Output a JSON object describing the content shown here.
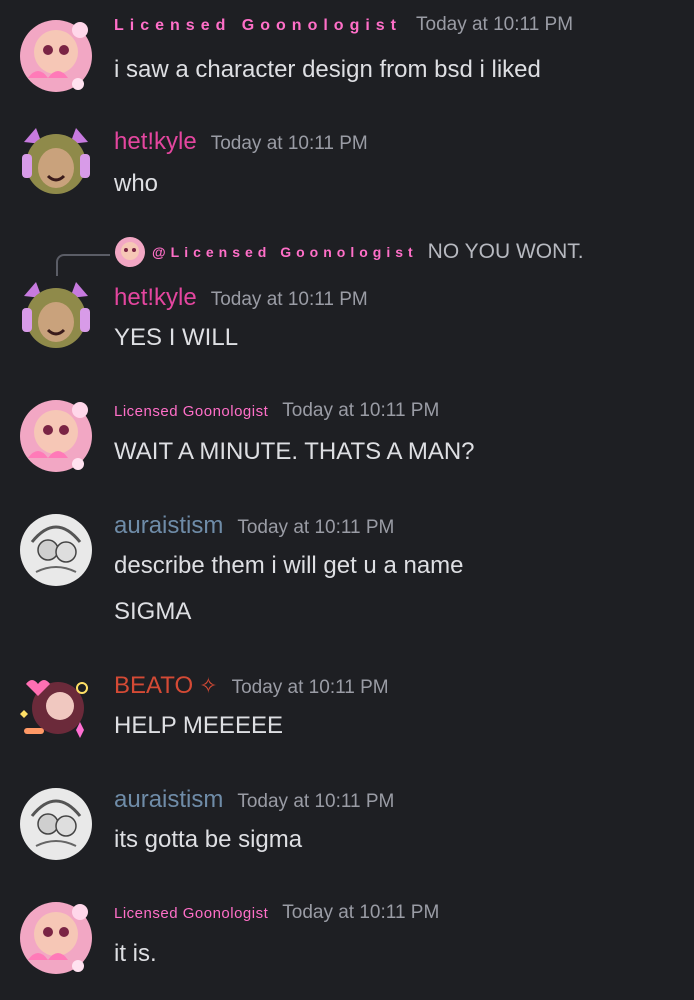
{
  "messages": [
    {
      "author": "Licensed Goonologist",
      "timestamp": "Today at 10:11 PM",
      "text": "i saw a character design from bsd i liked"
    },
    {
      "author": "het!kyle",
      "timestamp": "Today at 10:11 PM",
      "text": "who"
    },
    {
      "reply": {
        "mention": "@Licensed Goonologist",
        "text": "NO YOU WONT."
      },
      "author": "het!kyle",
      "timestamp": "Today at 10:11 PM",
      "text": "YES I WILL"
    },
    {
      "author": "Licensed Goonologist",
      "timestamp": "Today at 10:11 PM",
      "text": "WAIT A MINUTE. THATS A MAN?"
    },
    {
      "author": "auraistism",
      "timestamp": "Today at 10:11 PM",
      "text": "describe them i will get u a name",
      "text2": "SIGMA"
    },
    {
      "author": "BEATO",
      "badge": "✧",
      "timestamp": "Today at 10:11 PM",
      "text": "HELP MEEEEE"
    },
    {
      "author": "auraistism",
      "timestamp": "Today at 10:11 PM",
      "text": "its gotta be sigma"
    },
    {
      "author": "Licensed Goonologist",
      "timestamp": "Today at 10:11 PM",
      "text": "it is."
    }
  ],
  "colors": {
    "background": "#1e1f23",
    "goonologist": "#ff6fc8",
    "kyle": "#e4469f",
    "auraistism": "#6f8ca8",
    "beato": "#d44a35",
    "timestamp": "#9a9ca5"
  },
  "icons": [
    "avatar-pink-hearts",
    "avatar-cat-headphones",
    "avatar-sketch",
    "avatar-beato-sparkles"
  ]
}
